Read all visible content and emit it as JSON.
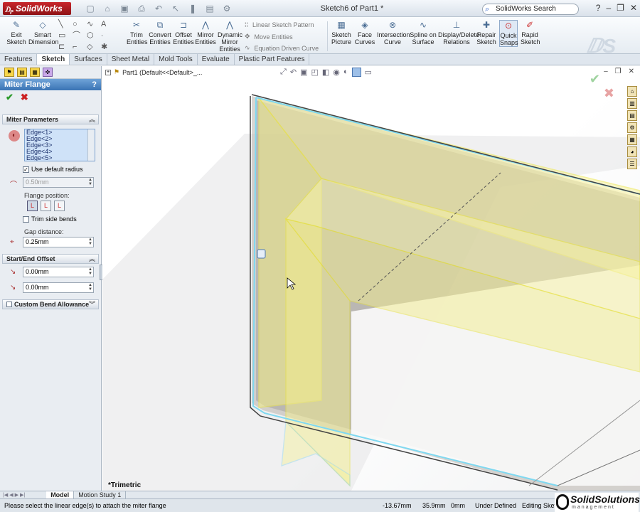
{
  "app": {
    "name": "SolidWorks",
    "document_title": "Sketch6 of Part1 *",
    "search_placeholder": "SolidWorks Search"
  },
  "ribbon": {
    "exit_sketch": "Exit Sketch",
    "smart_dimension": "Smart Dimension",
    "trim_entities": "Trim Entities",
    "convert_entities": "Convert Entities",
    "offset_entities": "Offset Entities",
    "mirror_entities": "Mirror Entities",
    "dynamic_mirror": "Dynamic Mirror Entities",
    "linear_sketch_pattern": "Linear Sketch Pattern",
    "move_entities": "Move Entities",
    "equation_driven_curve": "Equation Driven Curve",
    "sketch_picture": "Sketch Picture",
    "face_curves": "Face Curves",
    "intersection_curve": "Intersection Curve",
    "spline_on_surface": "Spline on Surface",
    "display_delete_relations": "Display/Delete Relations",
    "repair_sketch": "Repair Sketch",
    "quick_snaps": "Quick Snaps",
    "rapid_sketch": "Rapid Sketch"
  },
  "tabs": [
    "Features",
    "Sketch",
    "Surfaces",
    "Sheet Metal",
    "Mold Tools",
    "Evaluate",
    "Plastic Part Features"
  ],
  "active_tab": "Sketch",
  "property_manager": {
    "title": "Miter Flange",
    "help": "?",
    "miter_parameters": {
      "header": "Miter Parameters",
      "edges": [
        "Edge<1>",
        "Edge<2>",
        "Edge<3>",
        "Edge<4>",
        "Edge<5>"
      ],
      "use_default_radius_label": "Use default radius",
      "use_default_radius_checked": true,
      "radius_value": "0.50mm",
      "flange_position_label": "Flange position:",
      "trim_side_bends_label": "Trim side bends",
      "trim_side_bends_checked": false,
      "gap_distance_label": "Gap distance:",
      "gap_distance_value": "0.25mm"
    },
    "start_end_offset": {
      "header": "Start/End Offset",
      "offset1": "0.00mm",
      "offset2": "0.00mm"
    },
    "custom_bend_allowance": {
      "header": "Custom Bend Allowance"
    }
  },
  "viewport": {
    "tree_item": "Part1  (Default<<Default>_...",
    "view_orientation": "*Trimetric"
  },
  "bottom_tabs": [
    "Model",
    "Motion Study 1"
  ],
  "status_bar": {
    "message": "Please select the linear edge(s) to attach the miter flange",
    "x": "-13.67mm",
    "y": "35.9mm",
    "z": "0mm",
    "definition": "Under Defined",
    "editing": "Editing Sketc"
  },
  "brand": {
    "name": "SolidSolutions",
    "sub": "management"
  },
  "colors": {
    "pm_header": "#3a73b4",
    "preview_yellow": "#f3ef4f",
    "edge_cyan": "#7fd8f0",
    "ok_green": "#2b9a2b",
    "cancel_red": "#cc2222"
  }
}
